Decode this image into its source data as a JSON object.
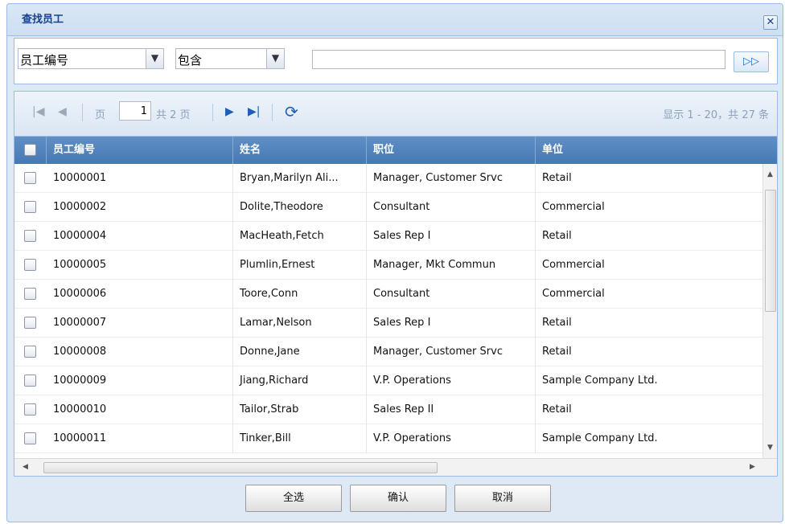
{
  "dialog": {
    "title": "查找员工",
    "close_symbol": "✕"
  },
  "search": {
    "field_value": "员工编号",
    "operator_value": "包含",
    "keyword_value": "",
    "go_symbol": "▷▷"
  },
  "pager": {
    "page_label": "页",
    "current_page": "1",
    "total_pages": "共 2 页",
    "display_info": "显示 1 - 20，共 27 条"
  },
  "table": {
    "columns": [
      "员工编号",
      "姓名",
      "职位",
      "单位"
    ],
    "rows": [
      [
        "10000001",
        "Bryan,Marilyn Ali...",
        "Manager, Customer Srvc",
        "Retail"
      ],
      [
        "10000002",
        "Dolite,Theodore",
        "Consultant",
        "Commercial"
      ],
      [
        "10000004",
        "MacHeath,Fetch",
        "Sales Rep I",
        "Retail"
      ],
      [
        "10000005",
        "Plumlin,Ernest",
        "Manager, Mkt Commun",
        "Commercial"
      ],
      [
        "10000006",
        "Toore,Conn",
        "Consultant",
        "Commercial"
      ],
      [
        "10000007",
        "Lamar,Nelson",
        "Sales Rep I",
        "Retail"
      ],
      [
        "10000008",
        "Donne,Jane",
        "Manager, Customer Srvc",
        "Retail"
      ],
      [
        "10000009",
        "Jiang,Richard",
        "V.P. Operations",
        "Sample Company Ltd."
      ],
      [
        "10000010",
        "Tailor,Strab",
        "Sales Rep II",
        "Retail"
      ],
      [
        "10000011",
        "Tinker,Bill",
        "V.P. Operations",
        "Sample Company Ltd."
      ]
    ]
  },
  "buttons": {
    "select_all": "全选",
    "confirm": "确认",
    "cancel": "取消"
  },
  "colors": {
    "header_bg": "#4f82bd",
    "title_text": "#15428b",
    "panel_bg": "#dfe9f5"
  }
}
